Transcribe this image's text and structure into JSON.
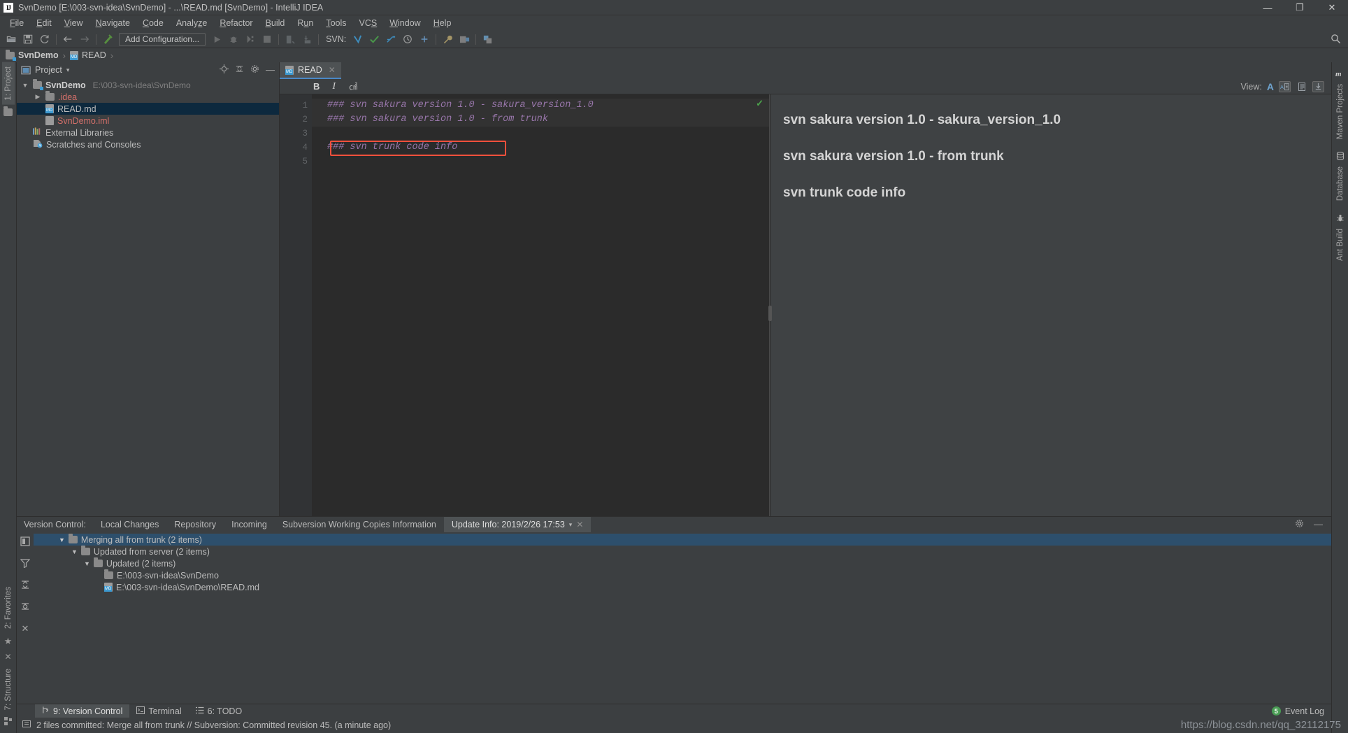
{
  "window": {
    "title": "SvnDemo [E:\\003-svn-idea\\SvnDemo] - ...\\READ.md [SvnDemo] - IntelliJ IDEA",
    "logo": "IJ",
    "minimize": "—",
    "maximize": "❐",
    "close": "✕"
  },
  "menubar": {
    "items": [
      {
        "label": "File"
      },
      {
        "label": "Edit"
      },
      {
        "label": "View"
      },
      {
        "label": "Navigate"
      },
      {
        "label": "Code"
      },
      {
        "label": "Analyze"
      },
      {
        "label": "Refactor"
      },
      {
        "label": "Build"
      },
      {
        "label": "Run"
      },
      {
        "label": "Tools"
      },
      {
        "label": "VCS"
      },
      {
        "label": "Window"
      },
      {
        "label": "Help"
      }
    ]
  },
  "toolbar": {
    "add_configuration": "Add Configuration...",
    "svn_label": "SVN:",
    "icons": [
      "open-folder-icon",
      "save-all-icon",
      "sync-refresh-icon",
      "back-arrow-icon",
      "forward-arrow-icon",
      "build-hammer-icon",
      "run-icon",
      "debug-icon",
      "run-coverage-icon",
      "stop-icon",
      "import-icon",
      "export-icon",
      "svn-update-icon",
      "svn-commit-icon",
      "svn-revert-icon",
      "svn-history-icon",
      "settings-wrench-icon",
      "project-structure-icon",
      "sdk-manager-icon",
      "search-everywhere-icon"
    ]
  },
  "breadcrumb": {
    "items": [
      {
        "label": "SvnDemo",
        "icon": "module-folder-icon"
      },
      {
        "label": "READ",
        "icon": "markdown-file-icon"
      }
    ],
    "separator": "›"
  },
  "left_strip": {
    "project_tab": "1: Project",
    "favorites_tab": "2: Favorites",
    "structure_tab": "7: Structure"
  },
  "right_strip": {
    "tabs": [
      "Maven Projects",
      "Database",
      "Ant Build"
    ]
  },
  "project_panel": {
    "title": "Project",
    "dropdown_caret": "▾",
    "actions": [
      "locate-target-icon",
      "collapse-all-icon",
      "settings-gear-icon",
      "hide-icon"
    ],
    "tree": [
      {
        "label": "SvnDemo",
        "path": "E:\\003-svn-idea\\SvnDemo",
        "indent": 0,
        "arrow": "▼",
        "icon": "module-folder-icon",
        "style": "bold",
        "selected": false
      },
      {
        "label": ".idea",
        "path": "",
        "indent": 1,
        "arrow": "▶",
        "icon": "folder-icon",
        "style": "red",
        "selected": false
      },
      {
        "label": "READ.md",
        "path": "",
        "indent": 2,
        "arrow": "",
        "icon": "markdown-file-icon",
        "style": "normal",
        "selected": true
      },
      {
        "label": "SvnDemo.iml",
        "path": "",
        "indent": 2,
        "arrow": "",
        "icon": "iml-file-icon",
        "style": "red",
        "selected": false
      },
      {
        "label": "External Libraries",
        "path": "",
        "indent": 0,
        "arrow": "",
        "icon": "libraries-icon",
        "style": "normal",
        "selected": false
      },
      {
        "label": "Scratches and Consoles",
        "path": "",
        "indent": 0,
        "arrow": "",
        "icon": "scratches-icon",
        "style": "normal",
        "selected": false
      }
    ]
  },
  "editor": {
    "tab": {
      "label": "READ",
      "icon": "markdown-file-icon",
      "close": "✕"
    },
    "format_toolbar": {
      "bold": "B",
      "italic": "I",
      "code": "㎠"
    },
    "view_label": "View:",
    "view_buttons": [
      "text-only-icon",
      "split-editor-preview-icon",
      "preview-only-icon",
      "scroll-sync-icon"
    ],
    "inspection_ok": "✓",
    "lines": [
      {
        "num": "1",
        "text": "### svn sakura version 1.0 - sakura_version_1.0",
        "highlight": false
      },
      {
        "num": "2",
        "text": "### svn sakura version 1.0 - from trunk",
        "highlight": true
      },
      {
        "num": "3",
        "text": "",
        "highlight": false
      },
      {
        "num": "4",
        "text": "### svn trunk code info",
        "highlight": false,
        "boxed": true
      },
      {
        "num": "5",
        "text": "",
        "highlight": false
      }
    ],
    "preview": [
      "svn sakura version 1.0 - sakura_version_1.0",
      "svn sakura version 1.0 - from trunk",
      "svn trunk code info"
    ]
  },
  "version_control": {
    "label": "Version Control:",
    "tabs": [
      {
        "label": "Local Changes",
        "active": false
      },
      {
        "label": "Repository",
        "active": false
      },
      {
        "label": "Incoming",
        "active": false
      },
      {
        "label": "Subversion Working Copies Information",
        "active": false
      },
      {
        "label": "Update Info: 2019/2/26 17:53",
        "active": true,
        "caret": "▾",
        "close": "✕"
      }
    ],
    "panel_actions": [
      "settings-gear-icon",
      "hide-panel-icon"
    ],
    "side_icons": [
      "group-by-icon",
      "filter-icon",
      "expand-all-icon",
      "collapse-all-icon",
      "remove-icon"
    ],
    "tree": [
      {
        "label": "Merging all from trunk (2 items)",
        "indent": 0,
        "arrow": "▼",
        "icon": "folder-icon",
        "selected": true
      },
      {
        "label": "Updated from server (2 items)",
        "indent": 1,
        "arrow": "▼",
        "icon": "folder-icon",
        "selected": false
      },
      {
        "label": "Updated (2 items)",
        "indent": 2,
        "arrow": "▼",
        "icon": "folder-icon",
        "selected": false
      },
      {
        "label": "E:\\003-svn-idea\\SvnDemo",
        "indent": 3,
        "arrow": "",
        "icon": "folder-icon",
        "selected": false
      },
      {
        "label": "E:\\003-svn-idea\\SvnDemo\\READ.md",
        "indent": 3,
        "arrow": "",
        "icon": "markdown-file-icon",
        "selected": false
      }
    ]
  },
  "bottom_tabs": {
    "items": [
      {
        "label": "9: Version Control",
        "icon": "vcs-branch-icon",
        "active": true
      },
      {
        "label": "Terminal",
        "icon": "terminal-icon",
        "active": false
      },
      {
        "label": "6: TODO",
        "icon": "todo-list-icon",
        "active": false
      }
    ],
    "event_log": {
      "label": "Event Log",
      "count": "5"
    }
  },
  "statusbar": {
    "icon": "message-icon",
    "message": "2 files committed: Merge all from trunk // Subversion: Committed revision 45. (a minute ago)"
  },
  "watermark": {
    "text": "https://blog.csdn.net/qq_32112175"
  },
  "colors": {
    "bg_chrome": "#3c3f41",
    "bg_editor": "#2b2b2b",
    "bg_preview": "#3f4244",
    "accent_blue": "#4a88c7",
    "selection": "#0d293e",
    "vcs_selection": "#2d4f6c",
    "error_box": "#f4503c",
    "markdown_text": "#9876aa",
    "green_ok": "#4ca64c"
  }
}
